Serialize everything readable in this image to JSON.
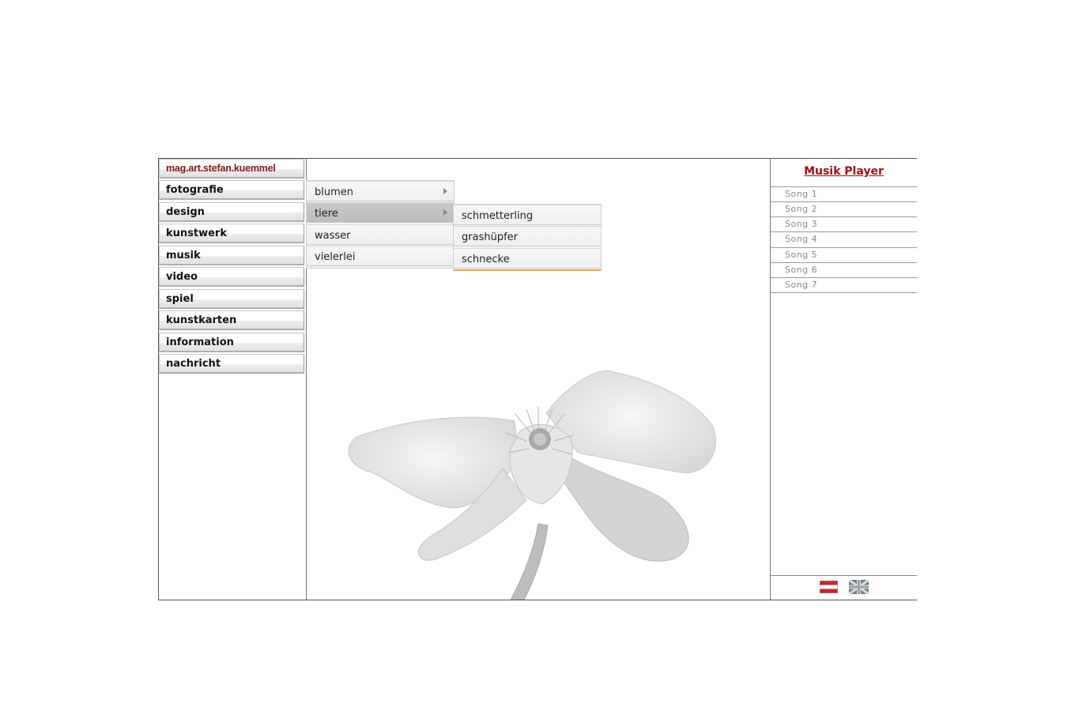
{
  "nav": {
    "brand": "mag.art.stefan.kuemmel",
    "items": [
      {
        "label": "fotografie"
      },
      {
        "label": "design"
      },
      {
        "label": "kunstwerk"
      },
      {
        "label": "musik"
      },
      {
        "label": "video"
      },
      {
        "label": "spiel"
      },
      {
        "label": "kunstkarten"
      },
      {
        "label": "information"
      },
      {
        "label": "nachricht"
      }
    ]
  },
  "submenu": {
    "items": [
      {
        "label": "blumen"
      },
      {
        "label": "tiere"
      },
      {
        "label": "wasser"
      },
      {
        "label": "vielerlei"
      }
    ]
  },
  "subsubmenu": {
    "items": [
      {
        "label": "schmetterling"
      },
      {
        "label": "grashüpfer"
      },
      {
        "label": "schnecke"
      }
    ]
  },
  "player": {
    "title": "Musik Player",
    "songs": [
      "Song 1",
      "Song 2",
      "Song 3",
      "Song 4",
      "Song 5",
      "Song 6",
      "Song 7"
    ]
  },
  "colors": {
    "brand": "#8b1414",
    "player_title": "#a01010",
    "border": "#555555"
  },
  "icons": {
    "flag_at": "austria-flag-icon",
    "flag_uk": "uk-flag-icon"
  }
}
